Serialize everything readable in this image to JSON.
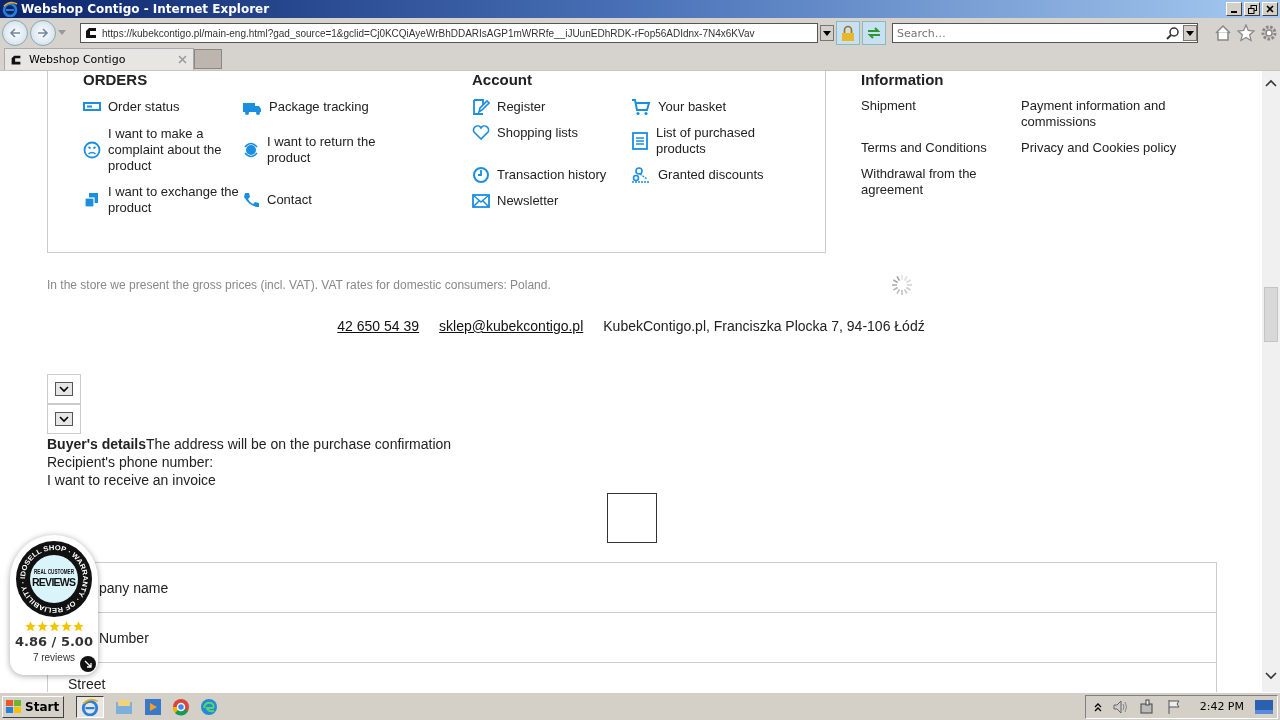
{
  "window": {
    "title": "Webshop Contigo - Internet Explorer"
  },
  "address_bar": {
    "url": "https://kubekcontigo.pl/main-eng.html?gad_source=1&gclid=Cj0KCQiAyeWrBhDDARIsAGP1mWRRfe__iJUunEDhRDK-rFop56ADIdnx-7N4x6KVav"
  },
  "search": {
    "placeholder": "Search…"
  },
  "tabs": [
    {
      "label": "Webshop Contigo",
      "selected": true
    }
  ],
  "footer": {
    "sections": [
      {
        "heading": "ORDERS",
        "links": [
          "Order status",
          "Package tracking",
          "I want to make a complaint about the product",
          "I want to return the product",
          "I want to exchange the product",
          "Contact"
        ]
      },
      {
        "heading": "Account",
        "links": [
          "Register",
          "Your basket",
          "Shopping lists",
          "List of purchased products",
          "Transaction history",
          "Granted discounts",
          "Newsletter"
        ]
      },
      {
        "heading": "Information",
        "links": [
          "Shipment",
          "Payment information and commissions",
          "Terms and Conditions",
          "Privacy and Cookies policy",
          "Withdrawal from the agreement"
        ]
      }
    ],
    "vat_note": "In the store we present the gross prices (incl. VAT). VAT rates for domestic consumers: Poland.",
    "contact": {
      "phone": "42 650 54 39",
      "email": "sklep@kubekcontigo.pl",
      "address": "KubekContigo.pl, Franciszka Plocka 7, 94-106 Łódź"
    }
  },
  "checkout": {
    "lines": [
      "**Buyer's details**The address will be on the purchase confirmation",
      "Recipient's phone number:",
      "I want to receive an invoice"
    ],
    "invoice_checkbox": {
      "checked": false
    },
    "fields": [
      {
        "label": "pany name"
      },
      {
        "label": "Number"
      },
      {
        "label": "Street"
      }
    ]
  },
  "reviews_badge": {
    "ring": "IDOSELL SHOP · WARRANTY · OF RELIABILITY ·",
    "subtitle": "REAL CUSTOMER",
    "title": "REVIEWS",
    "stars": 5,
    "rating": "4.86 / 5.00",
    "count": "7 reviews"
  },
  "taskbar": {
    "start": "Start",
    "clock": "2:42 PM"
  }
}
